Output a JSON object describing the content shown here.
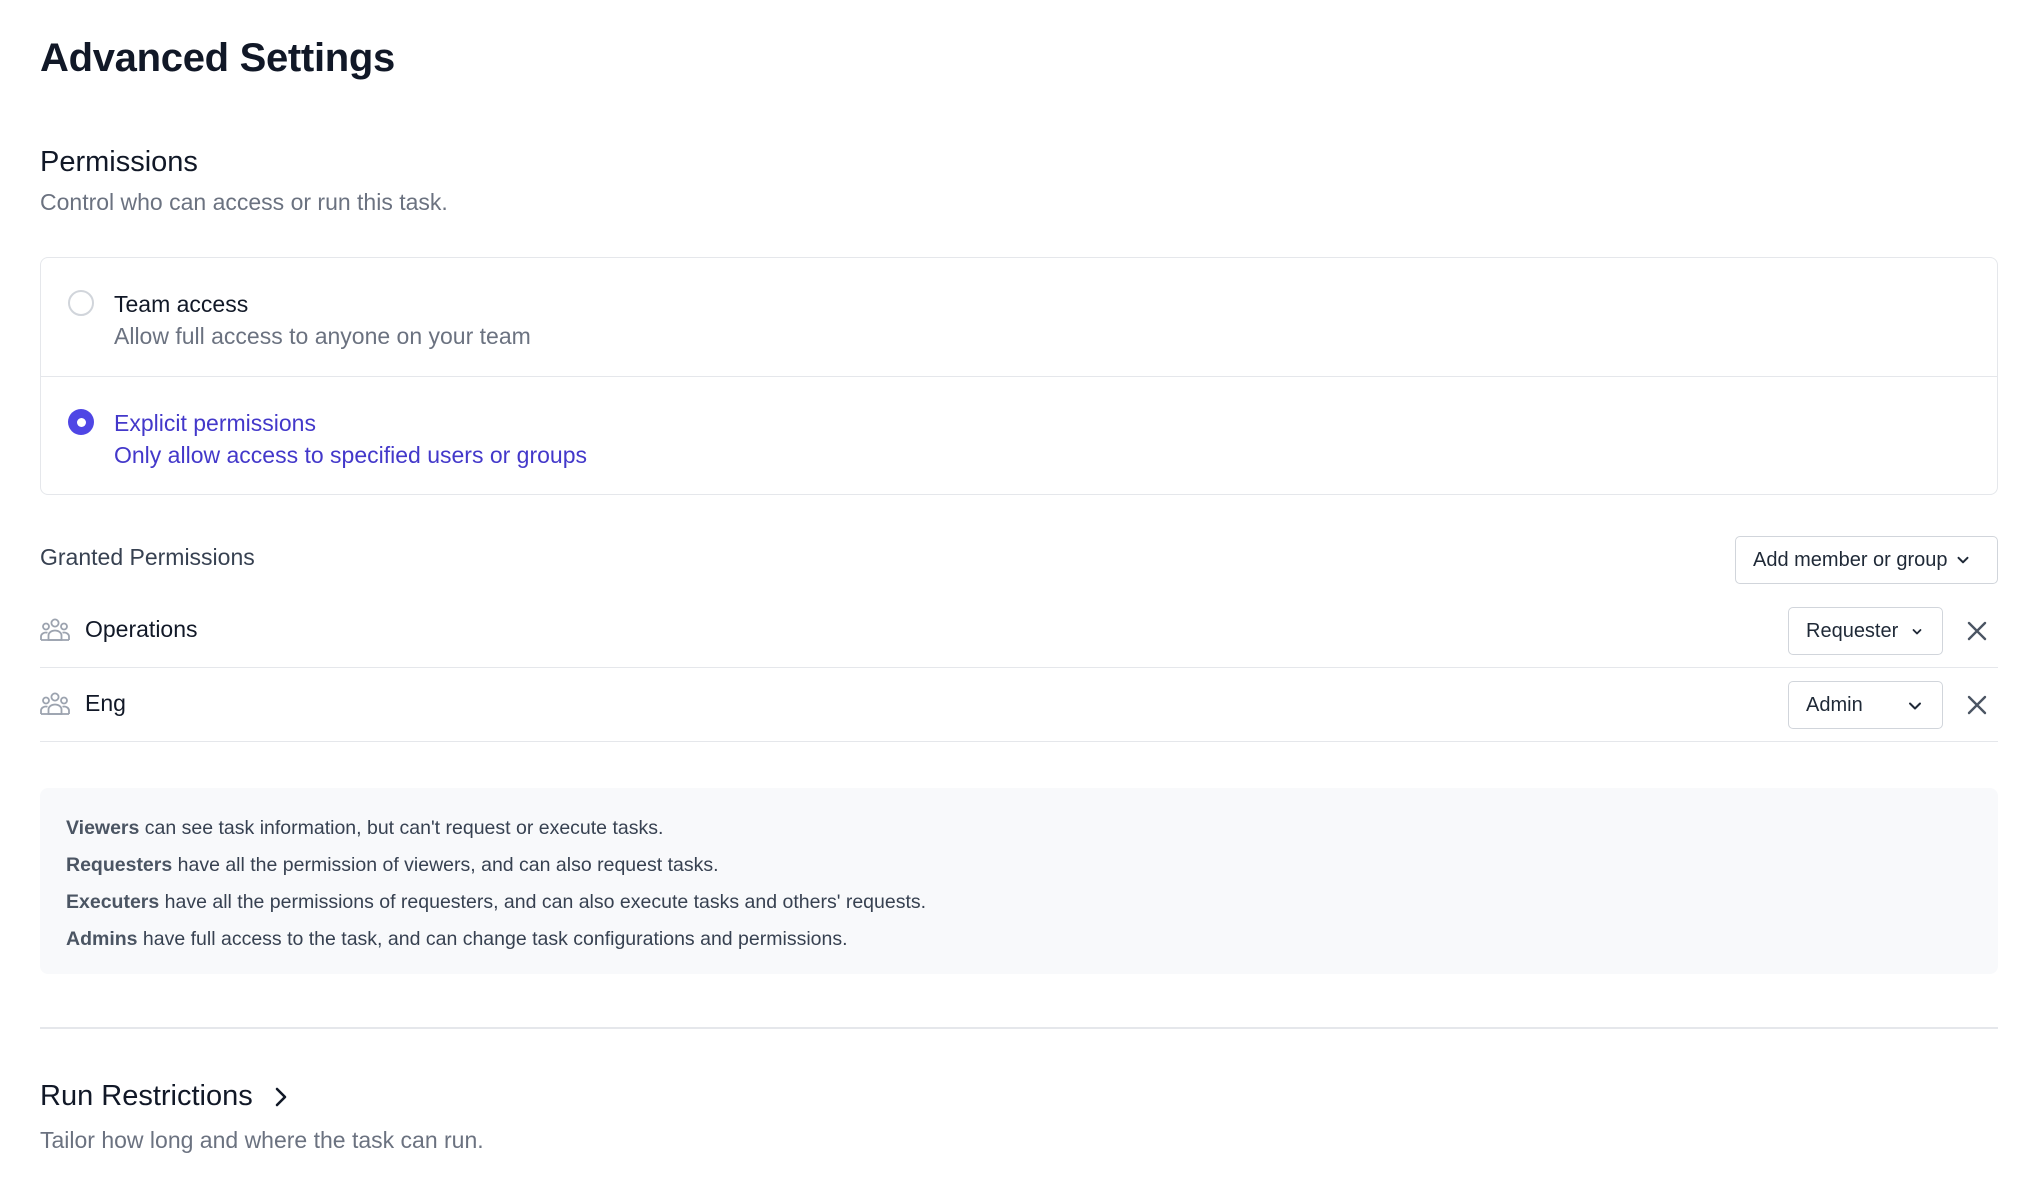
{
  "page": {
    "title": "Advanced Settings"
  },
  "permissions": {
    "title": "Permissions",
    "subtitle": "Control who can access or run this task.",
    "options": [
      {
        "label": "Team access",
        "description": "Allow full access to anyone on your team",
        "selected": false
      },
      {
        "label": "Explicit permissions",
        "description": "Only allow access to specified users or groups",
        "selected": true
      }
    ],
    "accent_color": "#4f46e5"
  },
  "granted": {
    "label": "Granted Permissions",
    "add_button_label": "Add member or group",
    "rows": [
      {
        "icon": "group-icon",
        "name": "Operations",
        "role": "Requester"
      },
      {
        "icon": "group-icon",
        "name": "Eng",
        "role": "Admin"
      }
    ]
  },
  "role_info": [
    {
      "role": "Viewers",
      "text": " can see task information, but can't request or execute tasks."
    },
    {
      "role": "Requesters",
      "text": " have all the permission of viewers, and can also request tasks."
    },
    {
      "role": "Executers",
      "text": " have all the permissions of requesters, and can also execute tasks and others' requests."
    },
    {
      "role": "Admins",
      "text": " have full access to the task, and can change task configurations and permissions."
    }
  ],
  "run_restrictions": {
    "title": "Run Restrictions",
    "subtitle": "Tailor how long and where the task can run."
  }
}
